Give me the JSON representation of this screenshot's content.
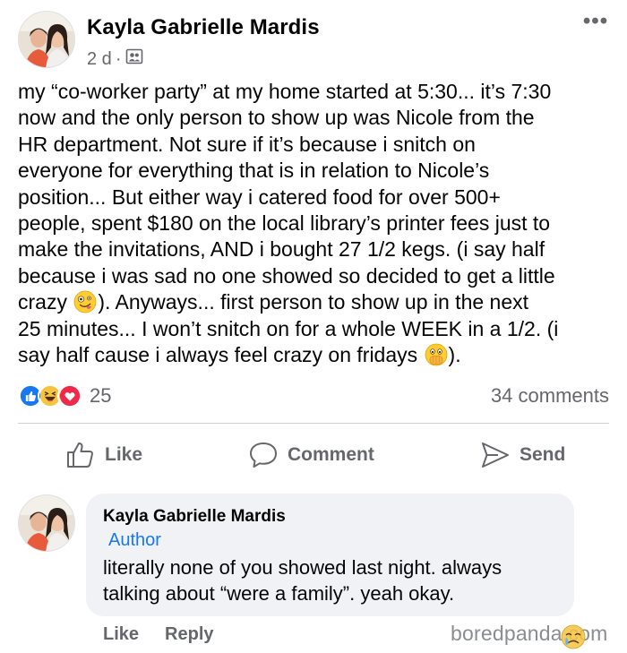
{
  "post": {
    "author_name": "Kayla Gabrielle Mardis",
    "time": "2 d",
    "separator": "·",
    "audience_icon": "friends-icon",
    "more_icon": "more-icon",
    "more_label": "•••",
    "text_lines": [
      "my “co-worker party” at my home started at 5:30... it’s 7:30",
      "now and the only person to show up was Nicole from the",
      "HR department. Not sure if it’s because i snitch on",
      "everyone for everything that is in relation to Nicole’s",
      "position... But either way i catered food for over 500+",
      "people, spent $180 on the local library’s printer fees just to",
      "make the invitations, AND i bought 27 1/2 kegs. (i say half",
      "because i was sad no one showed so decided to get a little"
    ],
    "line9_before": "crazy ",
    "line9_emoji": "zany-face-emoji",
    "line9_after": "). Anyways... first person to show up in the next",
    "line10": "25 minutes... I won’t snitch on for a whole WEEK in a 1/2. (i",
    "line11_before": "say half cause i always feel crazy on fridays ",
    "line11_emoji": "face-with-open-eyes-and-hand-over-mouth-emoji",
    "line11_after": ")."
  },
  "stats": {
    "reaction_icons": [
      "like-reaction-icon",
      "haha-reaction-icon",
      "love-reaction-icon"
    ],
    "reaction_count": "25",
    "comments_count": "34 comments"
  },
  "actions": {
    "like_label": "Like",
    "comment_label": "Comment",
    "send_label": "Send"
  },
  "comment": {
    "author_name": "Kayla Gabrielle Mardis",
    "badge": "Author",
    "text_line1": "literally none of you showed last night. always",
    "text_line2": "talking about “were a family”. yeah okay.",
    "like_label": "Like",
    "reply_label": "Reply"
  },
  "watermark": {
    "text": "boredpanda.com",
    "emoji": "crying-face-emoji"
  },
  "colors": {
    "text": "#050505",
    "secondary_text": "#65676b",
    "brand_blue": "#1877f2",
    "comment_bubble": "#f0f2f5",
    "divider": "#ced0d4"
  }
}
